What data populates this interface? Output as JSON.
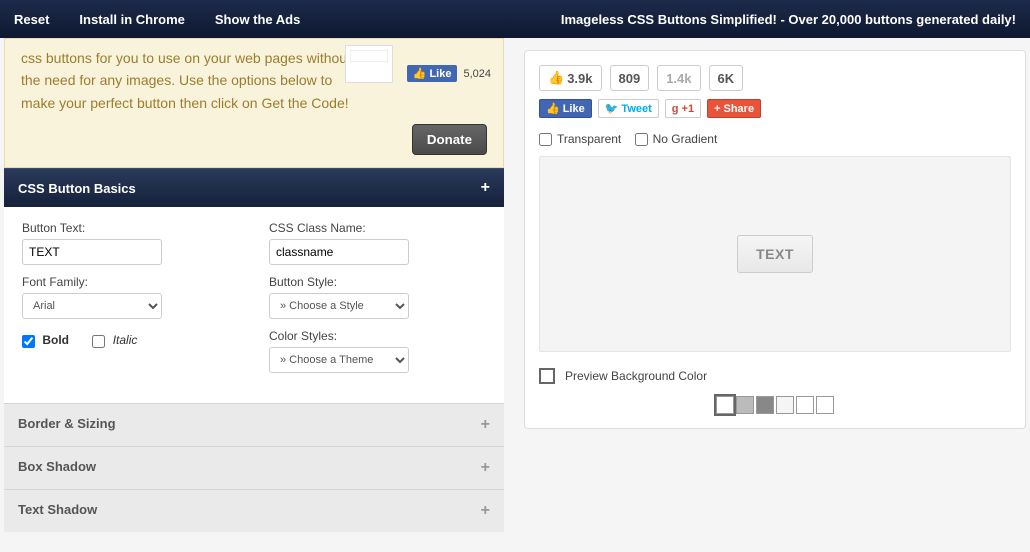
{
  "topbar": {
    "reset": "Reset",
    "install": "Install in Chrome",
    "show_ads": "Show the Ads",
    "tagline": "Imageless CSS Buttons Simplified! - Over 20,000 buttons generated daily!"
  },
  "intro": {
    "text": "css buttons for you to use on your web pages without the need for any images. Use the options below to make your perfect button then click on Get the Code!",
    "fb_like_label": "Like",
    "fb_like_count": "5,024",
    "donate": "Donate"
  },
  "basics": {
    "title": "CSS Button Basics",
    "button_text_label": "Button Text:",
    "button_text_value": "TEXT",
    "font_family_label": "Font Family:",
    "font_family_value": "Arial",
    "bold_label": "Bold",
    "bold_checked": true,
    "italic_label": "Italic",
    "class_label": "CSS Class Name:",
    "class_value": "classname",
    "style_label": "Button Style:",
    "style_value": "» Choose a Style",
    "color_label": "Color Styles:",
    "color_value": "» Choose a Theme"
  },
  "panels": {
    "border": "Border & Sizing",
    "box_shadow": "Box Shadow",
    "text_shadow": "Text Shadow"
  },
  "social": {
    "counts": [
      "3.9k",
      "809",
      "1.4k",
      "6K"
    ],
    "like": "Like",
    "tweet": "Tweet",
    "gplus": "+1",
    "share": "Share"
  },
  "preview": {
    "transparent": "Transparent",
    "no_gradient": "No Gradient",
    "button_text": "TEXT",
    "bg_label": "Preview Background Color",
    "swatches": [
      "#ffffff",
      "#bbbbbb",
      "#888888",
      "#f5f5f5",
      "#ffffff",
      "#ffffff"
    ]
  }
}
